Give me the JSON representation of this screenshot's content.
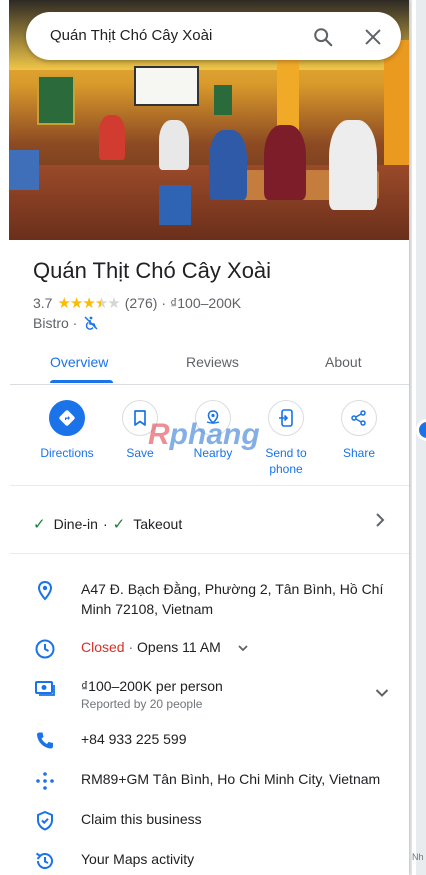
{
  "search": {
    "query": "Quán Thịt Chó Cây Xoài"
  },
  "place": {
    "name": "Quán Thịt Chó Cây Xoài",
    "rating": "3.7",
    "rating_stars": 3.7,
    "review_count": "(276)",
    "separator": "·",
    "price": "₫100–200K",
    "category": "Bistro ·"
  },
  "tabs": [
    {
      "label": "Overview",
      "active": true
    },
    {
      "label": "Reviews",
      "active": false
    },
    {
      "label": "About",
      "active": false
    }
  ],
  "actions": [
    {
      "label": "Directions",
      "icon": "directions-icon"
    },
    {
      "label": "Save",
      "icon": "bookmark-icon"
    },
    {
      "label": "Nearby",
      "icon": "nearby-icon"
    },
    {
      "label": "Send to phone",
      "icon": "send-to-phone-icon"
    },
    {
      "label": "Share",
      "icon": "share-icon"
    }
  ],
  "watermark": {
    "part1": "R",
    "part2": "phang"
  },
  "services": {
    "dine_in": "Dine-in",
    "dot": "·",
    "takeout": "Takeout"
  },
  "details": {
    "address": "A47 Đ. Bạch Đằng, Phường 2, Tân Bình, Hồ Chí Minh 72108, Vietnam",
    "hours_status": "Closed",
    "hours_sep": " · ",
    "hours_next": "Opens 11 AM",
    "price_per_person": "₫100–200K per person",
    "price_reported": "Reported by 20 people",
    "phone": "+84 933 225 599",
    "plus_code": "RM89+GM Tân Bình, Ho Chi Minh City, Vietnam",
    "claim": "Claim this business",
    "activity": "Your Maps activity"
  },
  "map": {
    "edge_label": "Nh"
  },
  "colors": {
    "accent": "#1a73e8",
    "closed": "#d93025",
    "star": "#fbbc04",
    "check": "#188038"
  }
}
